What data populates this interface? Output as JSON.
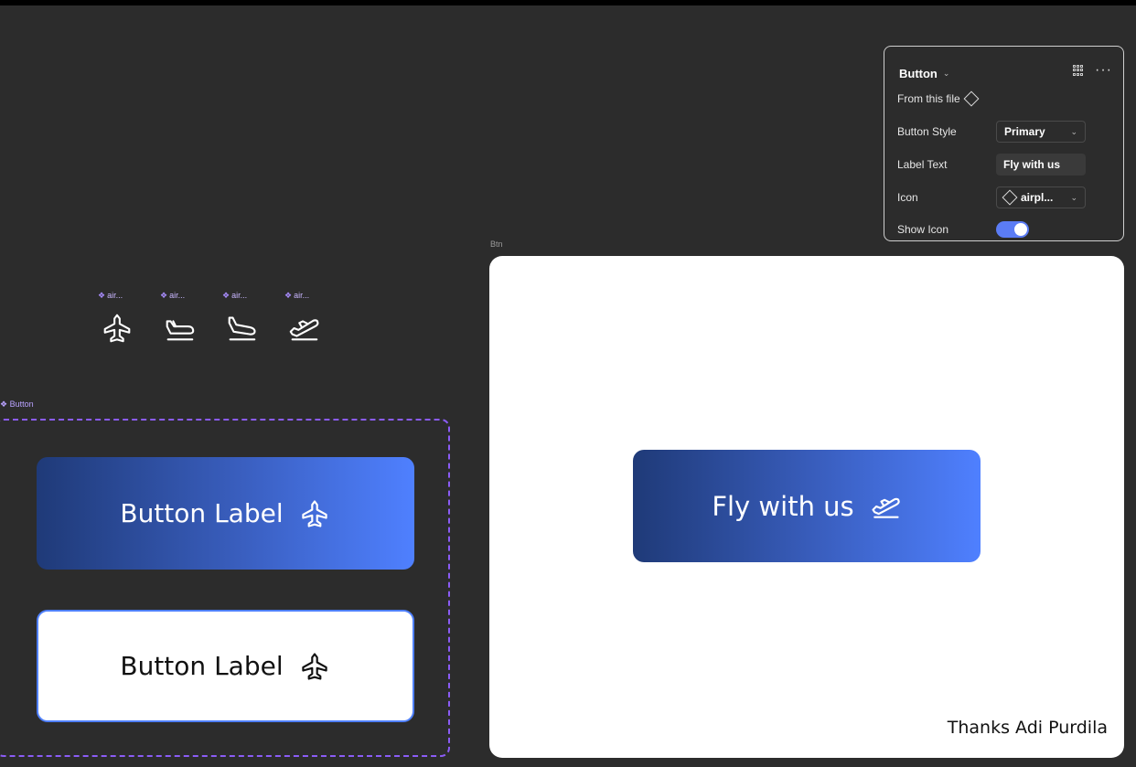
{
  "icons": [
    {
      "tag": "air...",
      "icon": "airplane-icon"
    },
    {
      "tag": "air...",
      "icon": "airplane-landed-icon"
    },
    {
      "tag": "air...",
      "icon": "airplane-landing-icon"
    },
    {
      "tag": "air...",
      "icon": "airplane-takeoff-icon"
    }
  ],
  "component_set": {
    "tag": "Button",
    "primary_label": "Button Label",
    "secondary_label": "Button Label"
  },
  "frame": {
    "tag": "Btn",
    "button_label": "Fly with us",
    "credit": "Thanks Adi Purdila"
  },
  "panel": {
    "title": "Button",
    "from_file": "From this file",
    "rows": [
      {
        "label": "Button Style",
        "value": "Primary"
      },
      {
        "label": "Label Text",
        "value": "Fly with us"
      },
      {
        "label": "Icon",
        "value": "airpl..."
      },
      {
        "label": "Show Icon",
        "value": true
      }
    ]
  },
  "colors": {
    "canvas": "#2c2c2c",
    "gradient_start": "#1f3a78",
    "gradient_end": "#4f80ff",
    "component_border": "#8b5cf6",
    "toggle": "#5b7cf5"
  }
}
